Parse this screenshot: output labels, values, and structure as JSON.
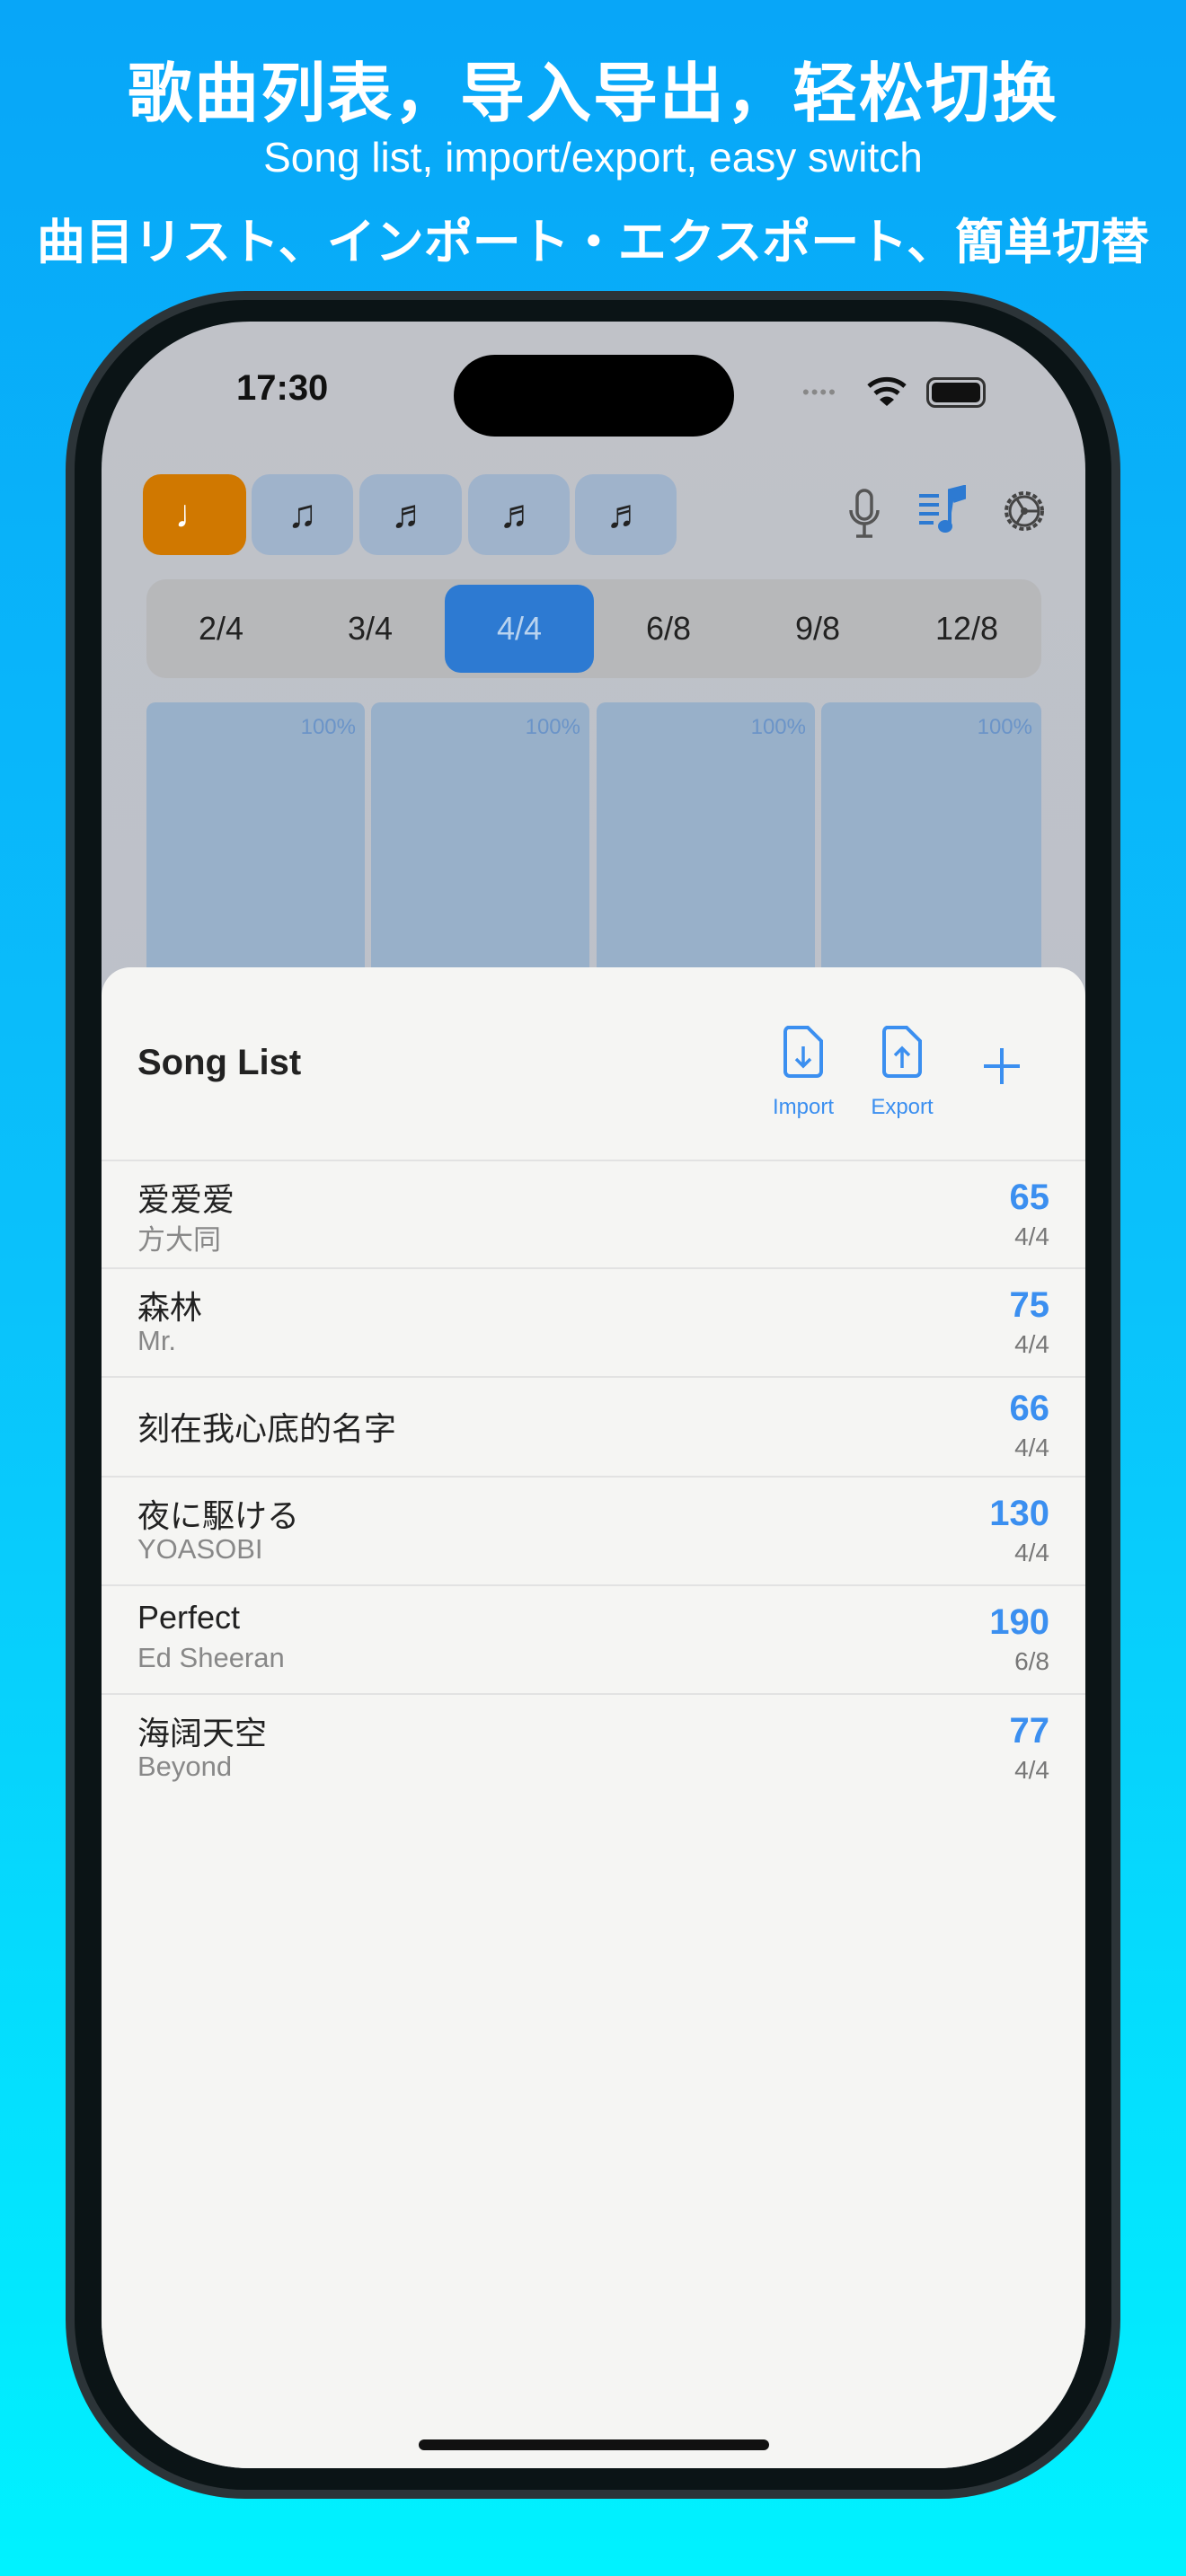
{
  "headline": {
    "zh": "歌曲列表，导入导出，轻松切换",
    "en": "Song list, import/export, easy switch",
    "ja": "曲目リスト、インポート・エクスポート、簡単切替"
  },
  "status": {
    "time": "17:30"
  },
  "toolbar": {
    "notes": [
      "♩",
      "♫",
      "♬",
      "♬",
      "♬"
    ],
    "active_index": 0
  },
  "time_signatures": {
    "options": [
      "2/4",
      "3/4",
      "4/4",
      "6/8",
      "9/8",
      "12/8"
    ],
    "selected": "4/4"
  },
  "beats": [
    "100%",
    "100%",
    "100%",
    "100%"
  ],
  "sheet": {
    "title": "Song List",
    "import_label": "Import",
    "export_label": "Export",
    "songs": [
      {
        "title": "爱爱爱",
        "artist": "方大同",
        "bpm": "65",
        "ts": "4/4"
      },
      {
        "title": "森林",
        "artist": "Mr.",
        "bpm": "75",
        "ts": "4/4"
      },
      {
        "title": "刻在我心底的名字",
        "artist": "",
        "bpm": "66",
        "ts": "4/4"
      },
      {
        "title": "夜に駆ける",
        "artist": "YOASOBI",
        "bpm": "130",
        "ts": "4/4"
      },
      {
        "title": "Perfect",
        "artist": "Ed Sheeran",
        "bpm": "190",
        "ts": "6/8"
      },
      {
        "title": "海阔天空",
        "artist": "Beyond",
        "bpm": "77",
        "ts": "4/4"
      }
    ]
  },
  "colors": {
    "accent": "#3b8ff0",
    "active_note": "#d07800",
    "selected_segment": "#2d7ad2"
  }
}
